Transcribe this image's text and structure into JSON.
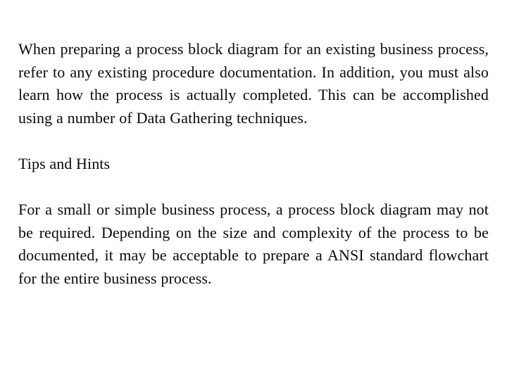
{
  "document": {
    "background_color": "#ffffff",
    "text_color": "#0a0a0a",
    "blocks": {
      "paragraph_1": "When preparing a process block diagram for an existing business process, refer to any existing procedure documentation.  In addition, you must also learn how the process is actually completed.  This can be accomplished using a number of Data Gathering techniques.",
      "heading_tips": "Tips and Hints",
      "paragraph_2": "For a small or simple business process, a process block diagram may not be required.  Depending on the size and complexity of the process to be documented, it may be acceptable to prepare a ANSI standard flowchart for the entire business process."
    }
  }
}
